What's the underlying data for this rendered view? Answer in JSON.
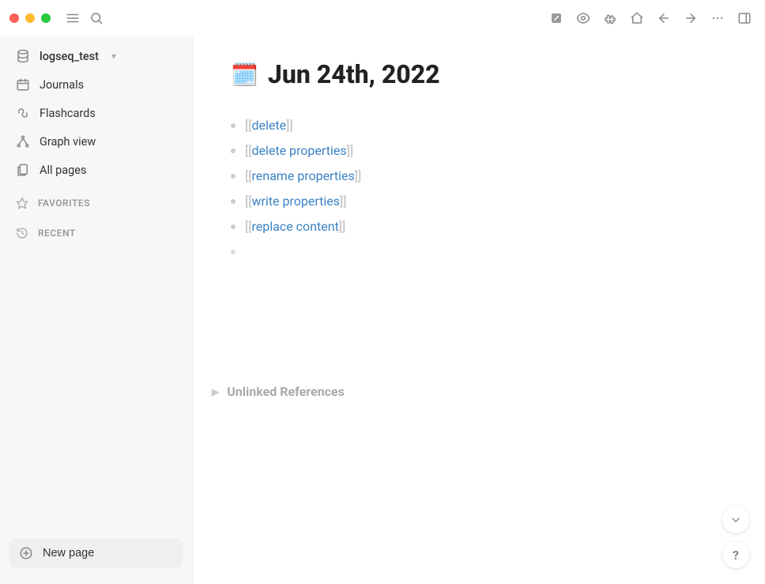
{
  "sidebar": {
    "graph_name": "logseq_test",
    "items": [
      {
        "label": "Journals"
      },
      {
        "label": "Flashcards"
      },
      {
        "label": "Graph view"
      },
      {
        "label": "All pages"
      }
    ],
    "favorites_label": "FAVORITES",
    "recent_label": "RECENT",
    "new_page_label": "New page"
  },
  "page": {
    "icon": "🗓️",
    "title": "Jun 24th, 2022",
    "blocks": [
      {
        "link": "delete"
      },
      {
        "link": "delete properties"
      },
      {
        "link": "rename properties"
      },
      {
        "link": "write properties"
      },
      {
        "link": "replace content"
      }
    ],
    "unlinked_label": "Unlinked References"
  }
}
